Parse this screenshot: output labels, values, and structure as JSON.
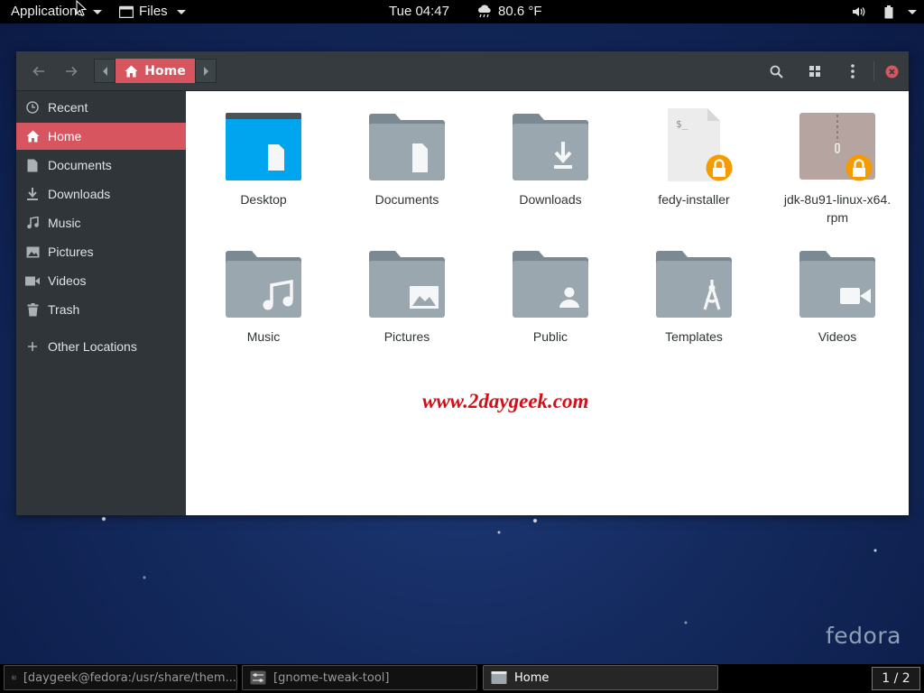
{
  "topbar": {
    "applications": "Applications",
    "files": "Files",
    "clock": "Tue 04:47",
    "weather": "80.6 °F"
  },
  "nautilus": {
    "path_current": "Home",
    "sidebar": [
      {
        "label": "Recent",
        "icon": "clock-icon"
      },
      {
        "label": "Home",
        "icon": "home-icon",
        "active": true
      },
      {
        "label": "Documents",
        "icon": "document-icon"
      },
      {
        "label": "Downloads",
        "icon": "download-icon"
      },
      {
        "label": "Music",
        "icon": "music-icon"
      },
      {
        "label": "Pictures",
        "icon": "picture-icon"
      },
      {
        "label": "Videos",
        "icon": "video-icon"
      },
      {
        "label": "Trash",
        "icon": "trash-icon"
      },
      {
        "label": "Other Locations",
        "icon": "plus-icon"
      }
    ],
    "items": [
      {
        "name": "Desktop",
        "type": "folder-desktop"
      },
      {
        "name": "Documents",
        "type": "folder-documents"
      },
      {
        "name": "Downloads",
        "type": "folder-downloads"
      },
      {
        "name": "fedy-installer",
        "type": "script-locked"
      },
      {
        "name": "jdk-8u91-linux-x64.\nrpm",
        "type": "archive-locked"
      },
      {
        "name": "Music",
        "type": "folder-music"
      },
      {
        "name": "Pictures",
        "type": "folder-pictures"
      },
      {
        "name": "Public",
        "type": "folder-public"
      },
      {
        "name": "Templates",
        "type": "folder-templates"
      },
      {
        "name": "Videos",
        "type": "folder-videos"
      }
    ],
    "watermark": "www.2daygeek.com"
  },
  "desktop": {
    "logo_text": "fedora"
  },
  "taskbar": {
    "tasks": [
      {
        "label": "[daygeek@fedora:/usr/share/them...",
        "active": false
      },
      {
        "label": "[gnome-tweak-tool]",
        "active": false
      },
      {
        "label": "Home",
        "active": true
      }
    ],
    "workspace": "1 / 2"
  },
  "colors": {
    "accent": "#d6555e",
    "folder": "#9aa7ae",
    "folder_tab": "#7b8a92",
    "desktop_folder": "#00a5f0",
    "lock_badge": "#f59b00"
  }
}
